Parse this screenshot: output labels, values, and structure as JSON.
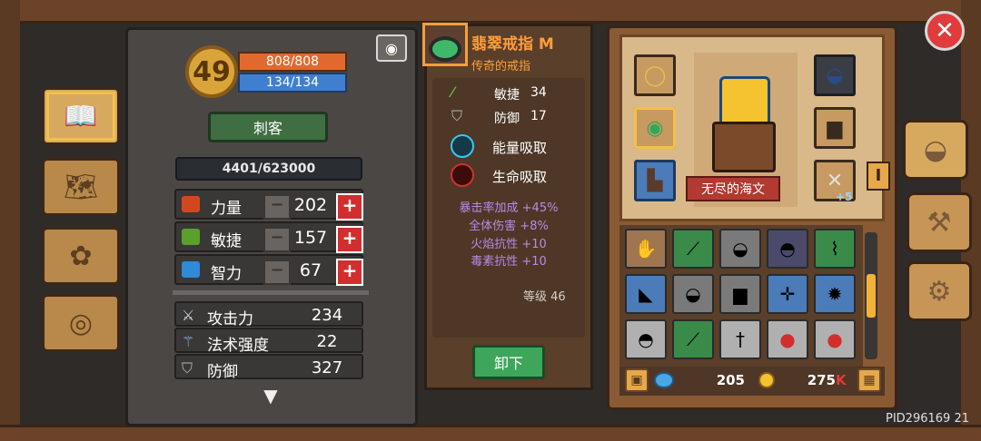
{
  "level": "49",
  "hp": "808/808",
  "mp": "134/134",
  "char_class": "刺客",
  "xp": "4401/623000",
  "stats": [
    {
      "label": "力量",
      "value": "202",
      "icon": "fist-icon",
      "color": "#d2481e"
    },
    {
      "label": "敏捷",
      "value": "157",
      "icon": "feather-icon",
      "color": "#5aa02c"
    },
    {
      "label": "智力",
      "value": "67",
      "icon": "book-icon",
      "color": "#2f8ad8"
    }
  ],
  "stat_minus": "−",
  "stat_plus": "+",
  "attributes": [
    {
      "label": "攻击力",
      "value": "234",
      "icon": "sword-icon"
    },
    {
      "label": "法术强度",
      "value": "22",
      "icon": "wand-icon"
    },
    {
      "label": "防御",
      "value": "327",
      "icon": "shield-icon"
    }
  ],
  "item": {
    "name": "翡翠戒指",
    "grade": "M",
    "subtitle": "传奇的戒指",
    "props": [
      {
        "label": "敏捷",
        "value": "34"
      },
      {
        "label": "防御",
        "value": "17"
      }
    ],
    "skills": [
      "能量吸取",
      "生命吸取"
    ],
    "effects": [
      "暴击率加成 +45%",
      "全体伤害 +8%",
      "火焰抗性 +10",
      "毒素抗性 +10"
    ],
    "level_label": "等级 46",
    "unequip": "卸下"
  },
  "equipment": {
    "nameplate": "无尽的海文",
    "weapon_bonus": "+5"
  },
  "currency": {
    "gems": "205",
    "coins": "275",
    "coins_suffix": "K"
  },
  "pid": "PID296169  21",
  "tab_marker": "I",
  "close": "✕"
}
